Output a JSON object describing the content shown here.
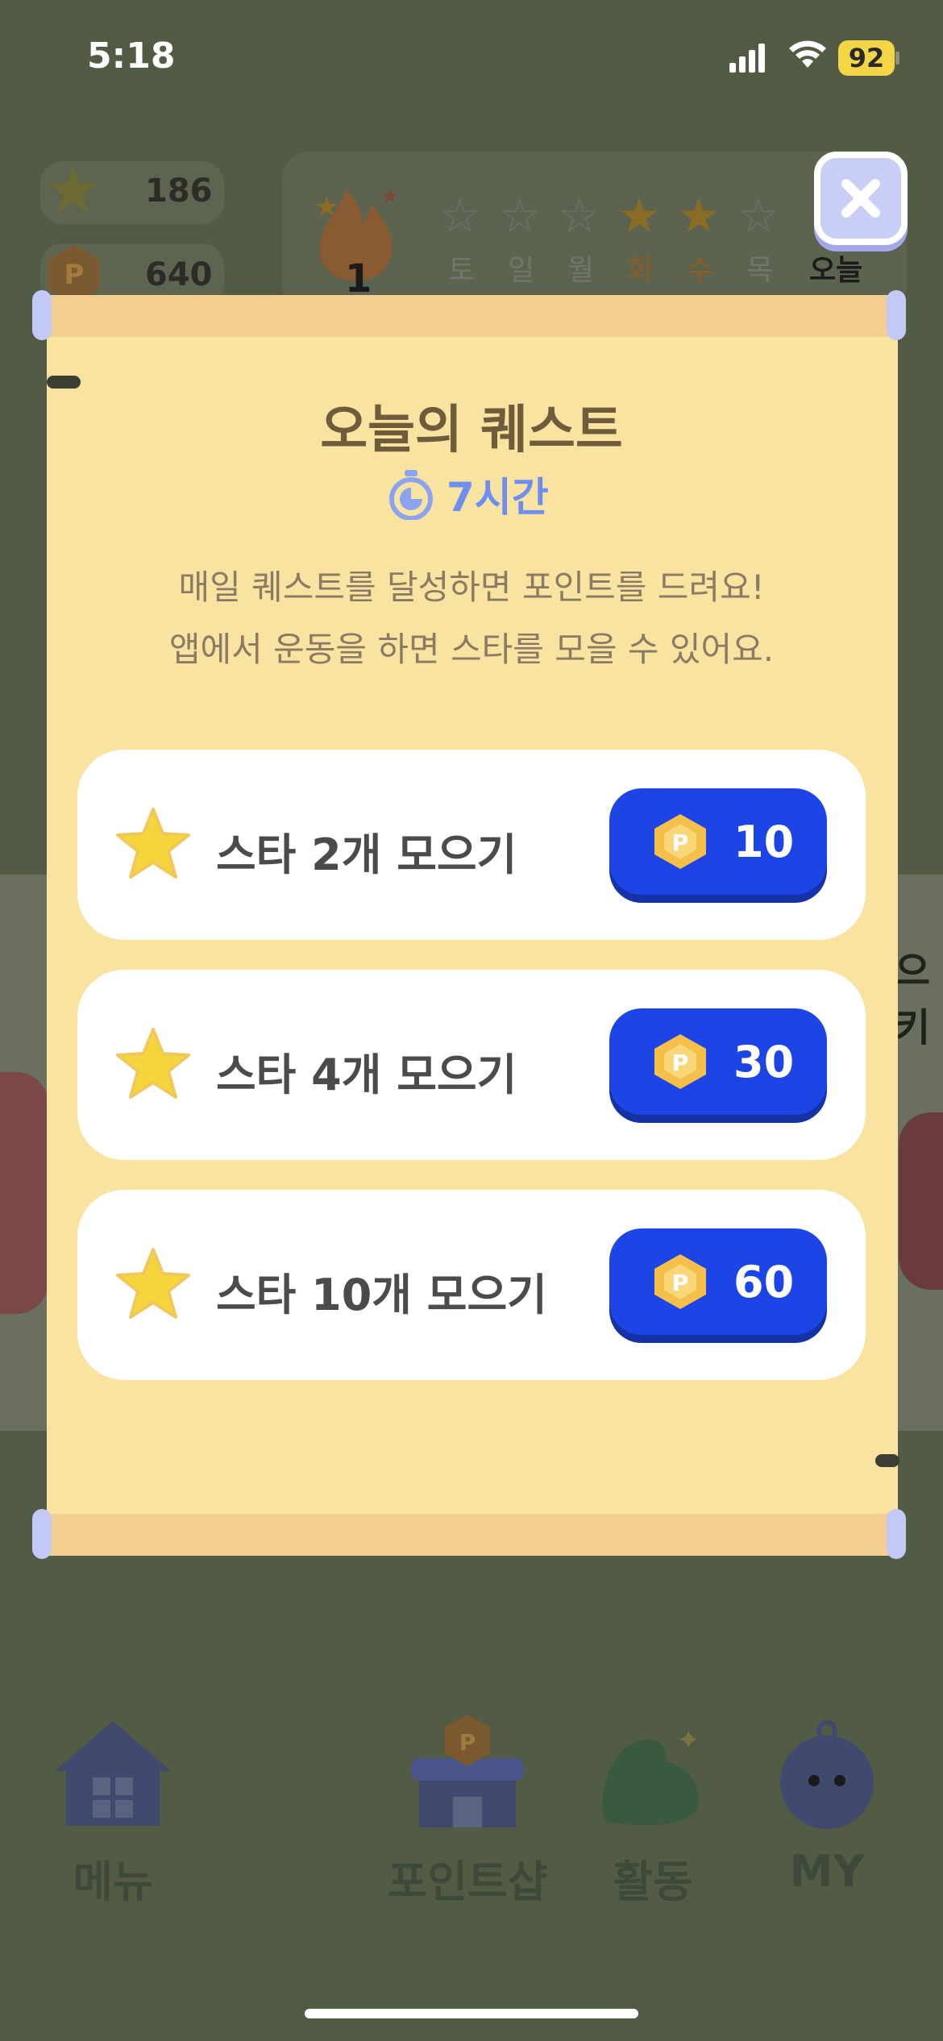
{
  "status": {
    "time": "5:18",
    "battery": "92"
  },
  "background": {
    "star_count": "186",
    "point_count": "640",
    "streak": "1",
    "week": [
      {
        "day": "토",
        "state": "off"
      },
      {
        "day": "일",
        "state": "off"
      },
      {
        "day": "월",
        "state": "off"
      },
      {
        "day": "화",
        "state": "on"
      },
      {
        "day": "수",
        "state": "on"
      },
      {
        "day": "목",
        "state": "off"
      },
      {
        "day": "오늘",
        "state": "today"
      }
    ],
    "side_text": "으키"
  },
  "nav": [
    {
      "label": "메뉴",
      "icon": "home-icon"
    },
    {
      "label": "포인트샵",
      "icon": "shop-icon"
    },
    {
      "label": "활동",
      "icon": "muscle-icon"
    },
    {
      "label": "MY",
      "icon": "character-icon"
    }
  ],
  "modal": {
    "title": "오늘의 퀘스트",
    "timer": "7시간",
    "desc_line1": "매일 퀘스트를 달성하면 포인트를 드려요!",
    "desc_line2": "앱에서 운동을 하면 스타를 모을 수 있어요.",
    "quests": [
      {
        "label": "스타 2개 모으기",
        "reward": "10"
      },
      {
        "label": "스타 4개 모으기",
        "reward": "30"
      },
      {
        "label": "스타 10개 모으기",
        "reward": "60"
      }
    ],
    "point_symbol": "P",
    "colors": {
      "accent": "#1d45e6",
      "paper": "#f8e3a0",
      "timer": "#6f8ef2"
    }
  }
}
